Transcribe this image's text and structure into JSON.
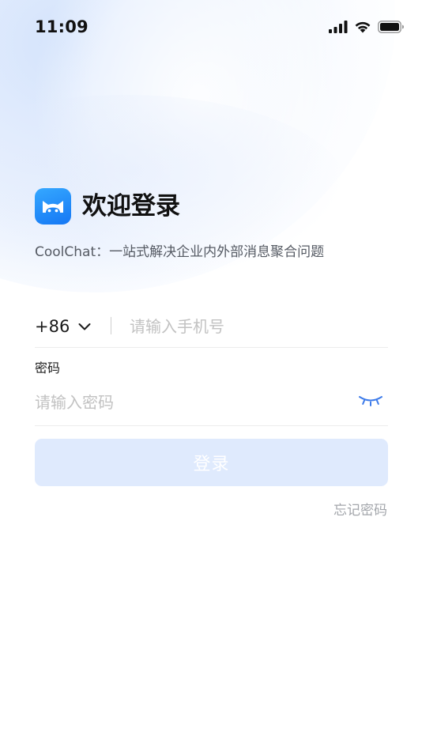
{
  "status_bar": {
    "time": "11:09"
  },
  "header": {
    "title": "欢迎登录",
    "subtitle": "CoolChat：一站式解决企业内外部消息聚合问题"
  },
  "phone": {
    "country_code": "+86",
    "placeholder": "请输入手机号"
  },
  "password": {
    "label": "密码",
    "placeholder": "请输入密码"
  },
  "login_button": {
    "label": "登录"
  },
  "forgot_password": {
    "label": "忘记密码"
  },
  "colors": {
    "brand": "#1e8bf8",
    "button_disabled": "#dfeafd",
    "eye_icon": "#3d7bea",
    "placeholder": "#c2c2c2"
  }
}
